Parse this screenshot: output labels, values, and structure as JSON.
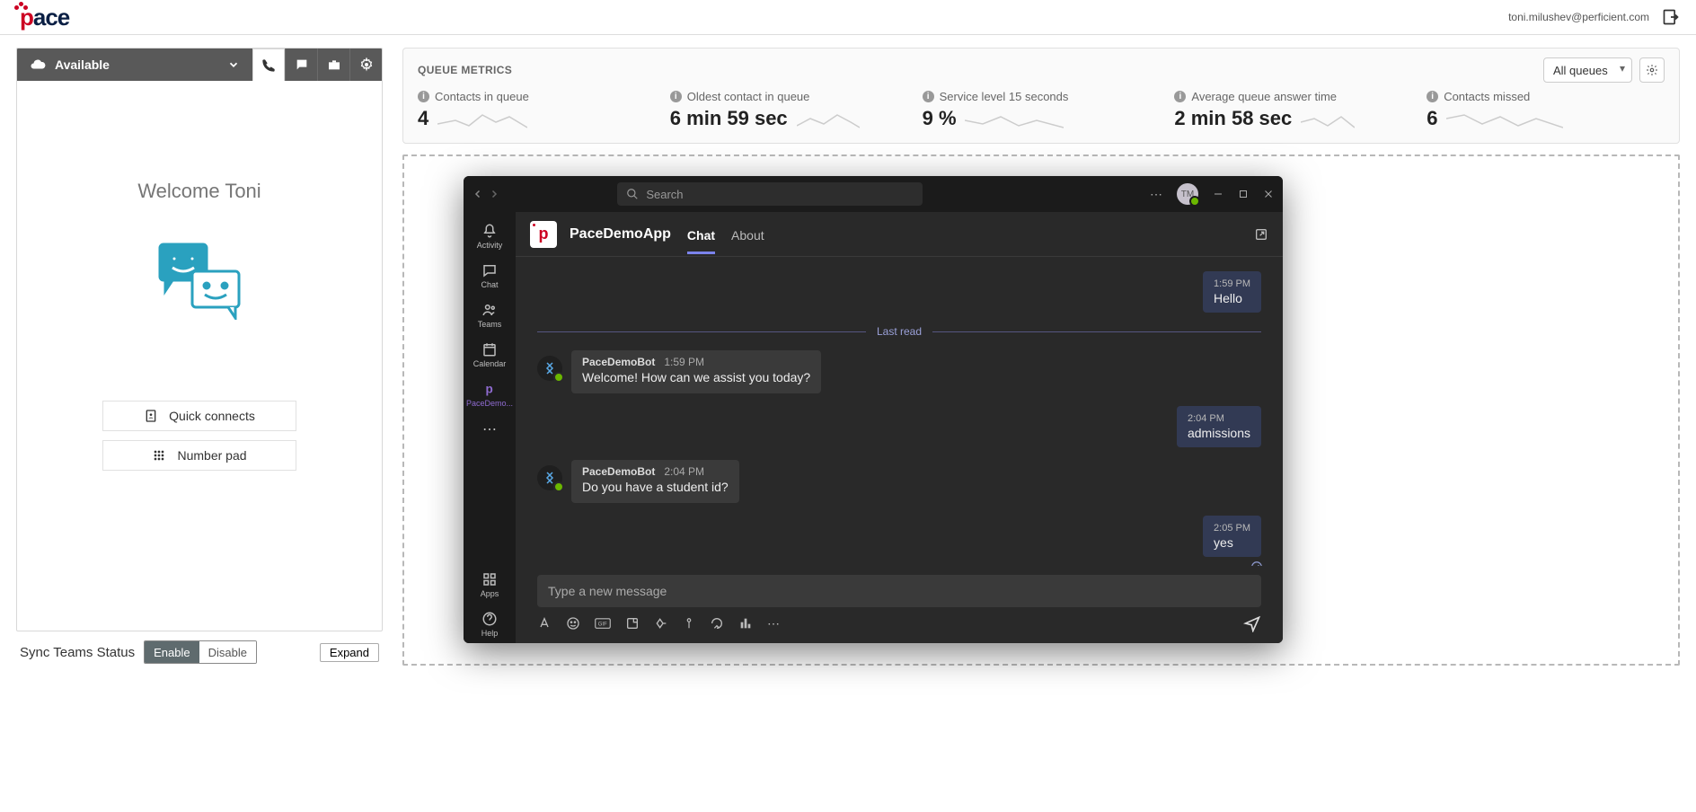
{
  "header": {
    "logo_text": "pace",
    "user_email": "toni.milushev@perficient.com"
  },
  "agent": {
    "status_text": "Available",
    "welcome": "Welcome Toni",
    "quick_connects_label": "Quick connects",
    "number_pad_label": "Number pad"
  },
  "sync": {
    "label": "Sync Teams Status",
    "enable": "Enable",
    "disable": "Disable",
    "expand": "Expand"
  },
  "queue": {
    "title": "QUEUE METRICS",
    "selector": "All queues",
    "metrics": [
      {
        "label": "Contacts in queue",
        "value": "4"
      },
      {
        "label": "Oldest contact in queue",
        "value": "6 min 59 sec"
      },
      {
        "label": "Service level 15 seconds",
        "value": "9 %"
      },
      {
        "label": "Average queue answer time",
        "value": "2 min 58 sec"
      },
      {
        "label": "Contacts missed",
        "value": "6"
      }
    ]
  },
  "teams": {
    "search_placeholder": "Search",
    "avatar_initials": "TM",
    "rail": {
      "activity": "Activity",
      "chat": "Chat",
      "teams": "Teams",
      "calendar": "Calendar",
      "app": "PaceDemo...",
      "apps": "Apps",
      "help": "Help"
    },
    "app": {
      "name": "PaceDemoApp",
      "tab_chat": "Chat",
      "tab_about": "About"
    },
    "chat": {
      "last_read": "Last read",
      "bot_name": "PaceDemoBot",
      "m1_time": "1:59 PM",
      "m1_text": "Hello",
      "b1_time": "1:59 PM",
      "b1_text": "Welcome! How can we assist you today?",
      "m2_time": "2:04 PM",
      "m2_text": "admissions",
      "b2_time": "2:04 PM",
      "b2_text": "Do you have a student id?",
      "m3_time": "2:05 PM",
      "m3_text": "yes",
      "compose_placeholder": "Type a new message"
    }
  }
}
